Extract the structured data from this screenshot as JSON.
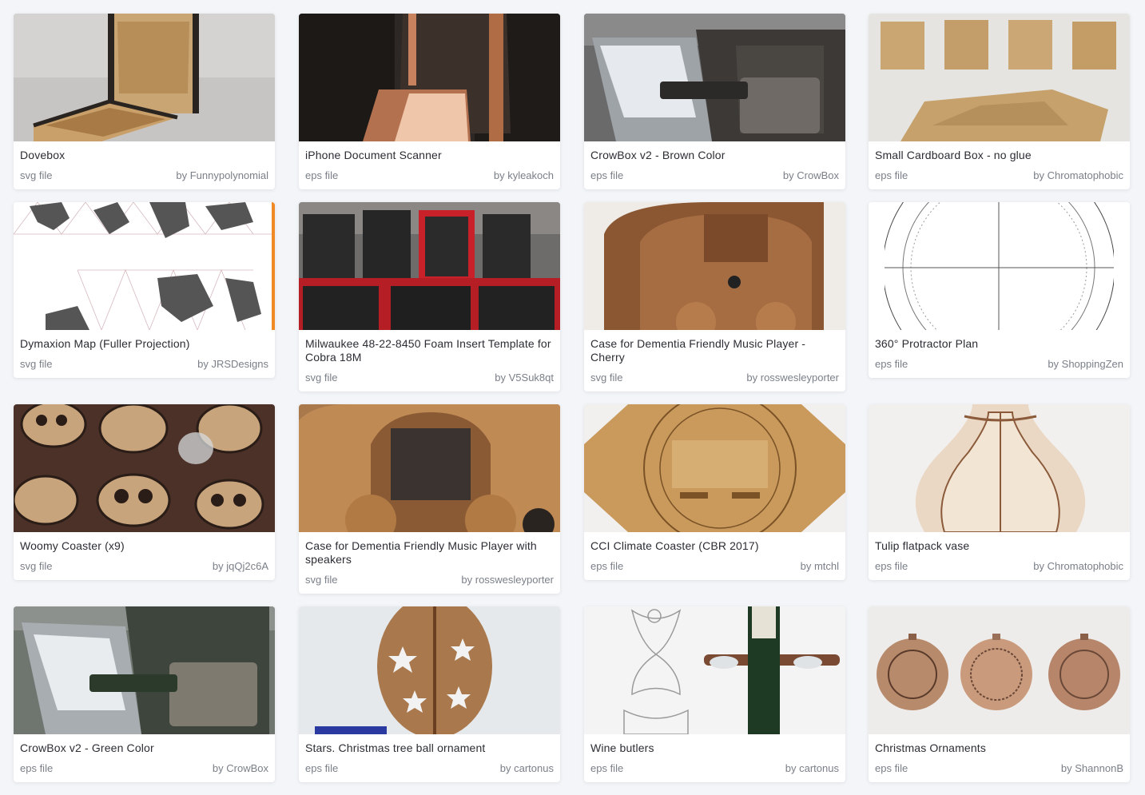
{
  "cards": [
    {
      "title": "Dovebox",
      "filetype": "svg file",
      "author": "Funnypolynomial",
      "image": "wooden-dovetail-box-photo",
      "bg": "#c9c6c2"
    },
    {
      "title": "iPhone Document Scanner",
      "filetype": "eps file",
      "author": "kyleakoch",
      "image": "wooden-scanner-stand-photo",
      "bg": "#2b2624"
    },
    {
      "title": "CrowBox v2 - Brown Color",
      "filetype": "eps file",
      "author": "CrowBox",
      "image": "crowbox-render",
      "bg": "#5a5a5a"
    },
    {
      "title": "Small Cardboard Box - no glue",
      "filetype": "eps file",
      "author": "Chromatophobic",
      "image": "cardboard-boxes-photo",
      "bg": "#e4e2df"
    },
    {
      "title": "Dymaxion Map (Fuller Projection)",
      "filetype": "svg file",
      "author": "JRSDesigns",
      "image": "dymaxion-map-pattern",
      "bg": "#ffffff"
    },
    {
      "title": "Milwaukee 48-22-8450 Foam Insert Template for Cobra 18M",
      "filetype": "svg file",
      "author": "V5Suk8qt",
      "image": "tool-cases-photo",
      "bg": "#3a3838"
    },
    {
      "title": "Case for Dementia Friendly Music Player - Cherry",
      "filetype": "svg file",
      "author": "rosswesleyporter",
      "image": "wooden-radio-cherry-photo",
      "bg": "#8a5a38"
    },
    {
      "title": "360° Protractor Plan",
      "filetype": "eps file",
      "author": "ShoppingZen",
      "image": "protractor-drawing",
      "bg": "#ffffff"
    },
    {
      "title": "Woomy Coaster (x9)",
      "filetype": "svg file",
      "author": "jqQj2c6A",
      "image": "cork-coasters-photo",
      "bg": "#4a3226"
    },
    {
      "title": "Case for Dementia Friendly Music Player with speakers",
      "filetype": "svg file",
      "author": "rosswesleyporter",
      "image": "wooden-radio-speakers-photo",
      "bg": "#a8784a"
    },
    {
      "title": "CCI Climate Coaster (CBR 2017)",
      "filetype": "eps file",
      "author": "mtchl",
      "image": "engraved-coaster-photo",
      "bg": "#c8a066"
    },
    {
      "title": "Tulip flatpack vase",
      "filetype": "eps file",
      "author": "Chromatophobic",
      "image": "flatpack-vase-photo",
      "bg": "#f1efed"
    },
    {
      "title": "CrowBox v2 - Green Color",
      "filetype": "eps file",
      "author": "CrowBox",
      "image": "crowbox-green-render",
      "bg": "#4e5a4e"
    },
    {
      "title": "Stars. Christmas tree ball ornament",
      "filetype": "eps file",
      "author": "cartonus",
      "image": "star-ornament-photo",
      "bg": "#e9ecef"
    },
    {
      "title": "Wine butlers",
      "filetype": "eps file",
      "author": "cartonus",
      "image": "wine-butler-photo",
      "bg": "#f4f4f4"
    },
    {
      "title": "Christmas Ornaments",
      "filetype": "eps file",
      "author": "ShannonB",
      "image": "christmas-ornaments-photo",
      "bg": "#eeecea"
    }
  ]
}
